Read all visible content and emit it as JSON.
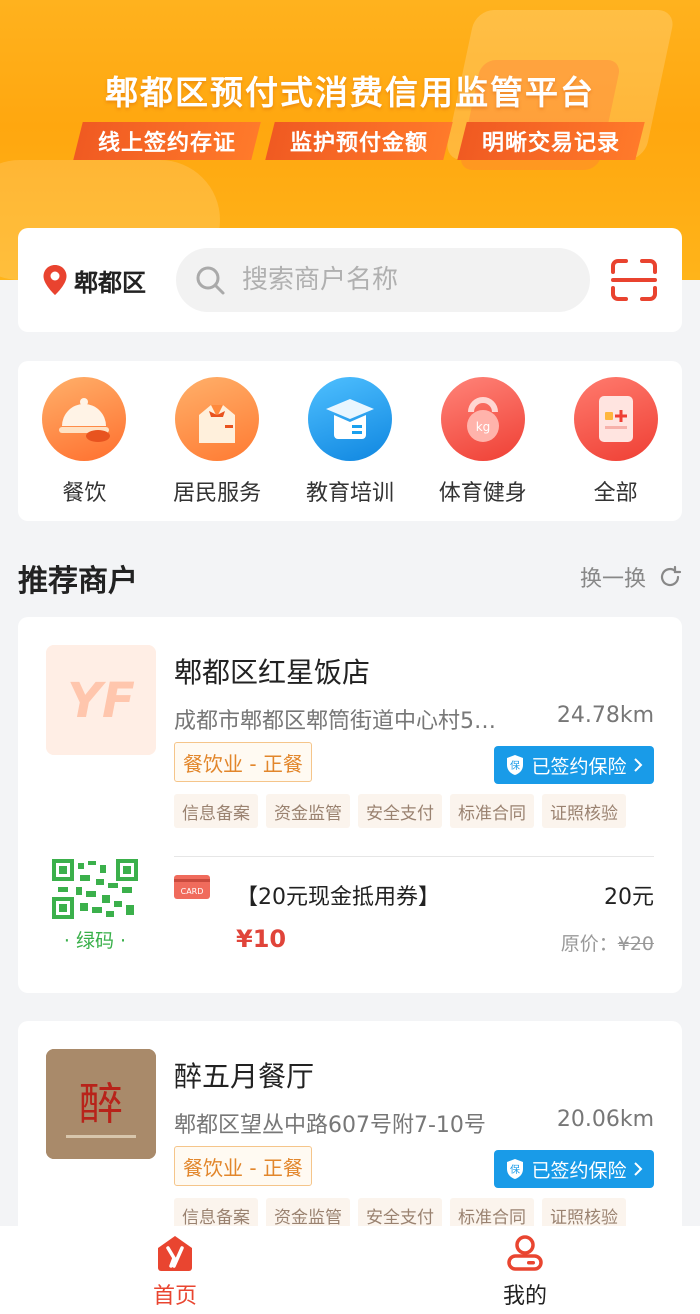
{
  "banner": {
    "title": "郫都区预付式消费信用监管平台",
    "tags": [
      "线上签约存证",
      "监护预付金额",
      "明晰交易记录"
    ]
  },
  "search": {
    "location": "郫都区",
    "placeholder": "搜索商户名称",
    "scan_icon": "scan-icon"
  },
  "categories": [
    {
      "label": "餐饮",
      "icon": "food-cloche-icon",
      "color": "#ff8a3d"
    },
    {
      "label": "居民服务",
      "icon": "waiter-icon",
      "color": "#ff8a3d"
    },
    {
      "label": "教育培训",
      "icon": "graduation-cap-icon",
      "color": "#1aa0ee"
    },
    {
      "label": "体育健身",
      "icon": "kettlebell-icon",
      "color": "#f5574a"
    },
    {
      "label": "全部",
      "icon": "tablet-plus-icon",
      "color": "#f5574a"
    }
  ],
  "section": {
    "title": "推荐商户",
    "refresh_label": "换一换"
  },
  "merchants": [
    {
      "name": "郫都区红星饭店",
      "address": "成都市郫都区郫筒街道中心村5…",
      "distance": "24.78km",
      "category": "餐饮业 - 正餐",
      "insurance": "已签约保险",
      "features": [
        "信息备案",
        "资金监管",
        "安全支付",
        "标准合同",
        "证照核验"
      ],
      "qr_label": "· 绿码 ·",
      "coupon": {
        "badge": "CARD",
        "title": "【20元现金抵用券】",
        "face_value": "20元",
        "price": "¥10",
        "original_label": "原价：",
        "original_price": "¥20"
      }
    },
    {
      "name": "醉五月餐厅",
      "address": "郫都区望丛中路607号附7-10号",
      "distance": "20.06km",
      "category": "餐饮业 - 正餐",
      "insurance": "已签约保险",
      "features": [
        "信息备案",
        "资金监管",
        "安全支付",
        "标准合同",
        "证照核验"
      ],
      "logo_text": "醉"
    }
  ],
  "nav": [
    {
      "label": "首页",
      "icon": "home-y-icon",
      "active": true
    },
    {
      "label": "我的",
      "icon": "user-icon",
      "active": false
    }
  ],
  "colors": {
    "brand": "#e94530",
    "banner": "#ffa70f",
    "insurance": "#199be8",
    "price": "#e0443a"
  }
}
